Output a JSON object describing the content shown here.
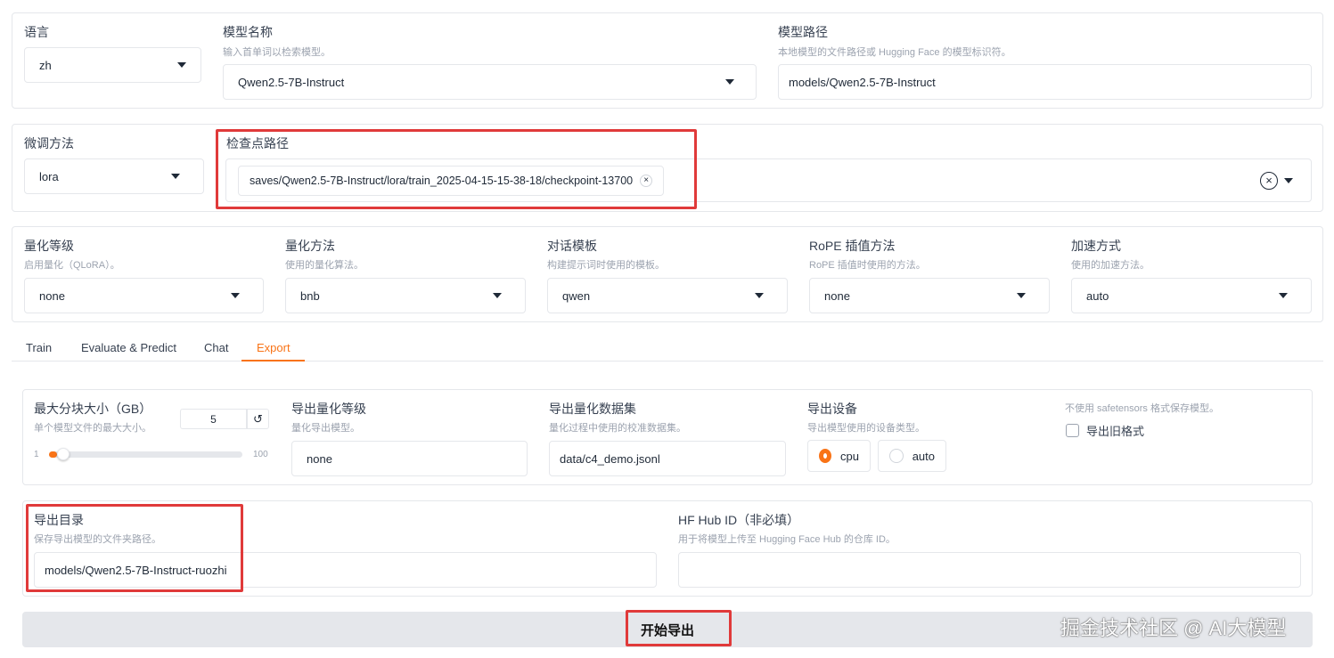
{
  "top": {
    "language": {
      "label": "语言",
      "value": "zh"
    },
    "model_name": {
      "label": "模型名称",
      "info": "输入首单词以检索模型。",
      "value": "Qwen2.5-7B-Instruct"
    },
    "model_path": {
      "label": "模型路径",
      "info": "本地模型的文件路径或 Hugging Face 的模型标识符。",
      "value": "models/Qwen2.5-7B-Instruct"
    }
  },
  "second": {
    "finetune": {
      "label": "微调方法",
      "value": "lora"
    },
    "checkpoint": {
      "label": "检查点路径",
      "tag": "saves/Qwen2.5-7B-Instruct/lora/train_2025-04-15-15-38-18/checkpoint-13700",
      "tag_close": "×",
      "clear": "×"
    }
  },
  "third": {
    "quant_bit": {
      "label": "量化等级",
      "info": "启用量化（QLoRA）。",
      "value": "none"
    },
    "quant_method": {
      "label": "量化方法",
      "info": "使用的量化算法。",
      "value": "bnb"
    },
    "template": {
      "label": "对话模板",
      "info": "构建提示词时使用的模板。",
      "value": "qwen"
    },
    "rope": {
      "label": "RoPE 插值方法",
      "info": "RoPE 插值时使用的方法。",
      "value": "none"
    },
    "booster": {
      "label": "加速方式",
      "info": "使用的加速方法。",
      "value": "auto"
    }
  },
  "tabs": [
    {
      "label": "Train",
      "active": false
    },
    {
      "label": "Evaluate & Predict",
      "active": false
    },
    {
      "label": "Chat",
      "active": false
    },
    {
      "label": "Export",
      "active": true
    }
  ],
  "export": {
    "shard": {
      "label": "最大分块大小（GB）",
      "info": "单个模型文件的最大大小。",
      "value": "5",
      "min": "1",
      "max": "100",
      "reset": "↺",
      "fraction": 0.04
    },
    "export_quant_bit": {
      "label": "导出量化等级",
      "info": "量化导出模型。",
      "value": "none"
    },
    "export_quant_dataset": {
      "label": "导出量化数据集",
      "info": "量化过程中使用的校准数据集。",
      "value": "data/c4_demo.jsonl"
    },
    "device": {
      "label": "导出设备",
      "info": "导出模型使用的设备类型。",
      "options": [
        "cpu",
        "auto"
      ],
      "selected": "cpu"
    },
    "legacy": {
      "info": "不使用 safetensors 格式保存模型。",
      "label": "导出旧格式",
      "checked": false
    },
    "export_dir": {
      "label": "导出目录",
      "info": "保存导出模型的文件夹路径。",
      "value": "models/Qwen2.5-7B-Instruct-ruozhi"
    },
    "hub_id": {
      "label": "HF Hub ID（非必填）",
      "info": "用于将模型上传至 Hugging Face Hub 的仓库 ID。",
      "value": ""
    },
    "button": "开始导出"
  },
  "watermark": "掘金技术社区 @ AI大模型",
  "colors": {
    "accent": "#f97316",
    "highlight": "#e03a3a"
  }
}
